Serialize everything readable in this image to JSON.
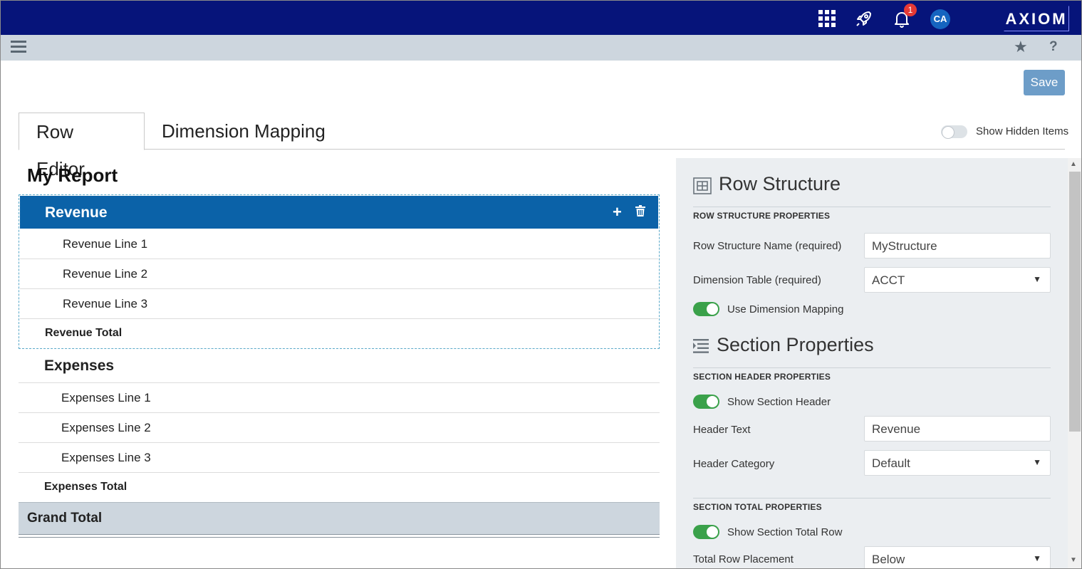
{
  "topbar": {
    "notification_count": "1",
    "avatar_initials": "CA",
    "brand": "AXIOM",
    "icons": [
      "apps-grid-icon",
      "rocket-icon",
      "bell-icon"
    ]
  },
  "toolbar": {
    "save_label": "Save",
    "icons": [
      "hamburger-menu-icon",
      "star-icon",
      "help-icon"
    ],
    "help_glyph": "?"
  },
  "tabs": [
    {
      "label": "Row Editor",
      "active": true
    },
    {
      "label": "Dimension Mapping",
      "active": false
    }
  ],
  "show_hidden_items": {
    "label": "Show Hidden Items",
    "enabled": false
  },
  "report": {
    "title": "My Report",
    "sections": [
      {
        "header": "Revenue",
        "selected": true,
        "lines": [
          "Revenue Line 1",
          "Revenue Line 2",
          "Revenue Line 3"
        ],
        "total": "Revenue Total"
      },
      {
        "header": "Expenses",
        "selected": false,
        "lines": [
          "Expenses Line 1",
          "Expenses Line 2",
          "Expenses Line 3"
        ],
        "total": "Expenses Total"
      }
    ],
    "grand_total": "Grand Total"
  },
  "panel": {
    "row_structure": {
      "heading": "Row Structure",
      "subheading": "ROW STRUCTURE PROPERTIES",
      "name_label": "Row Structure Name (required)",
      "name_value": "MyStructure",
      "dimension_label": "Dimension Table (required)",
      "dimension_value": "ACCT",
      "use_mapping_label": "Use Dimension Mapping",
      "use_mapping_enabled": true
    },
    "section_properties": {
      "heading": "Section Properties",
      "header_subheading": "SECTION HEADER PROPERTIES",
      "show_header_label": "Show Section Header",
      "show_header_enabled": true,
      "header_text_label": "Header Text",
      "header_text_value": "Revenue",
      "header_category_label": "Header Category",
      "header_category_value": "Default",
      "total_subheading": "SECTION TOTAL PROPERTIES",
      "show_total_label": "Show Section Total Row",
      "show_total_enabled": true,
      "placement_label": "Total Row Placement",
      "placement_value": "Below"
    }
  },
  "colors": {
    "topbar": "#06147a",
    "toolbar": "#cdd6de",
    "selected_section": "#0b62a8",
    "save_button": "#6d9dc8",
    "toggle_on": "#3aa14a",
    "badge": "#e53935"
  }
}
